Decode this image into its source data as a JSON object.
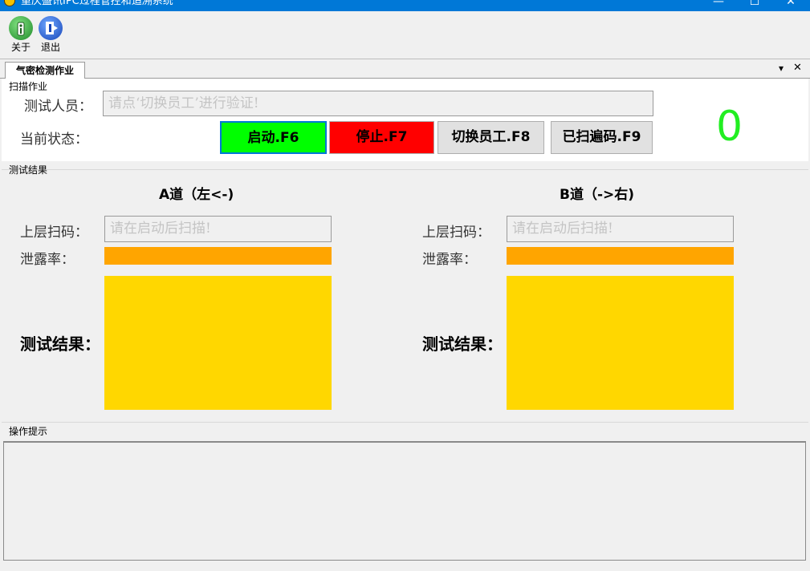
{
  "window": {
    "title": "重庆盛讯IPC过程管控和追溯系统",
    "minimize": "—",
    "maximize": "☐",
    "close": "✕"
  },
  "toolbar": {
    "about_label": "关于",
    "exit_label": "退出"
  },
  "tab": {
    "label": "气密检测作业",
    "dropdown_glyph": "▾",
    "close_glyph": "✕"
  },
  "scan": {
    "group_title": "扫描作业",
    "tester_label": "测试人员：",
    "tester_value": "请点‘切换员工’进行验证!",
    "status_label": "当前状态：",
    "buttons": {
      "start": "启动.F6",
      "stop": "停止.F7",
      "switch": "切换员工.F8",
      "scanned": "已扫遍码.F9"
    },
    "count": "0"
  },
  "results": {
    "group_title": "测试结果",
    "lane_a": {
      "header": "A道（左<-)",
      "scan_label": "上层扫码：",
      "scan_value": "请在启动后扫描!",
      "leak_label": "泄露率：",
      "result_label": "测试结果："
    },
    "lane_b": {
      "header": "B道（->右)",
      "scan_label": "上层扫码：",
      "scan_value": "请在启动后扫描!",
      "leak_label": "泄露率：",
      "result_label": "测试结果："
    }
  },
  "hints": {
    "group_title": "操作提示"
  },
  "colors": {
    "start": "#00ff00",
    "stop": "#ff0000",
    "leak_bar": "#ffa500",
    "result_box": "#ffd700",
    "counter": "#22ee22"
  }
}
